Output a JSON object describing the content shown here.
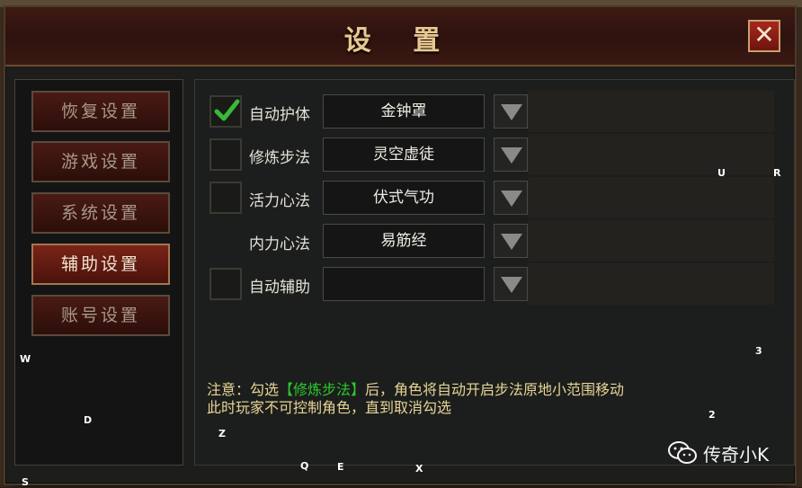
{
  "window": {
    "title": "设 置",
    "close_symbol": "✕"
  },
  "sidebar": {
    "tabs": [
      {
        "label": "恢复设置",
        "active": false
      },
      {
        "label": "游戏设置",
        "active": false
      },
      {
        "label": "系统设置",
        "active": false
      },
      {
        "label": "辅助设置",
        "active": true
      },
      {
        "label": "账号设置",
        "active": false
      }
    ]
  },
  "settings": {
    "rows": [
      {
        "label": "自动护体",
        "value": "金钟罩",
        "checked": true,
        "has_checkbox": true
      },
      {
        "label": "修炼步法",
        "value": "灵空虚徒",
        "checked": false,
        "has_checkbox": true
      },
      {
        "label": "活力心法",
        "value": "伏式气功",
        "checked": false,
        "has_checkbox": true
      },
      {
        "label": "内力心法",
        "value": "易筋经",
        "checked": false,
        "has_checkbox": false
      },
      {
        "label": "自动辅助",
        "value": "",
        "checked": false,
        "has_checkbox": true
      }
    ]
  },
  "notice": {
    "prefix": "注意：勾选",
    "highlight": "【修炼步法】",
    "suffix": "后，角色将自动开启步法原地小范围移动",
    "line2": "此时玩家不可控制角色，直到取消勾选"
  },
  "watermark": {
    "text": "传奇小K",
    "icon": "wechat-icon"
  },
  "markers": [
    "U",
    "R",
    "3",
    "W",
    "D",
    "2",
    "Z",
    "Q",
    "E",
    "X",
    "S"
  ],
  "colors": {
    "accent_gold": "#e8c890",
    "notice_text": "#e8d496",
    "notice_highlight": "#2ec82e",
    "check_green": "#3ab83a"
  }
}
